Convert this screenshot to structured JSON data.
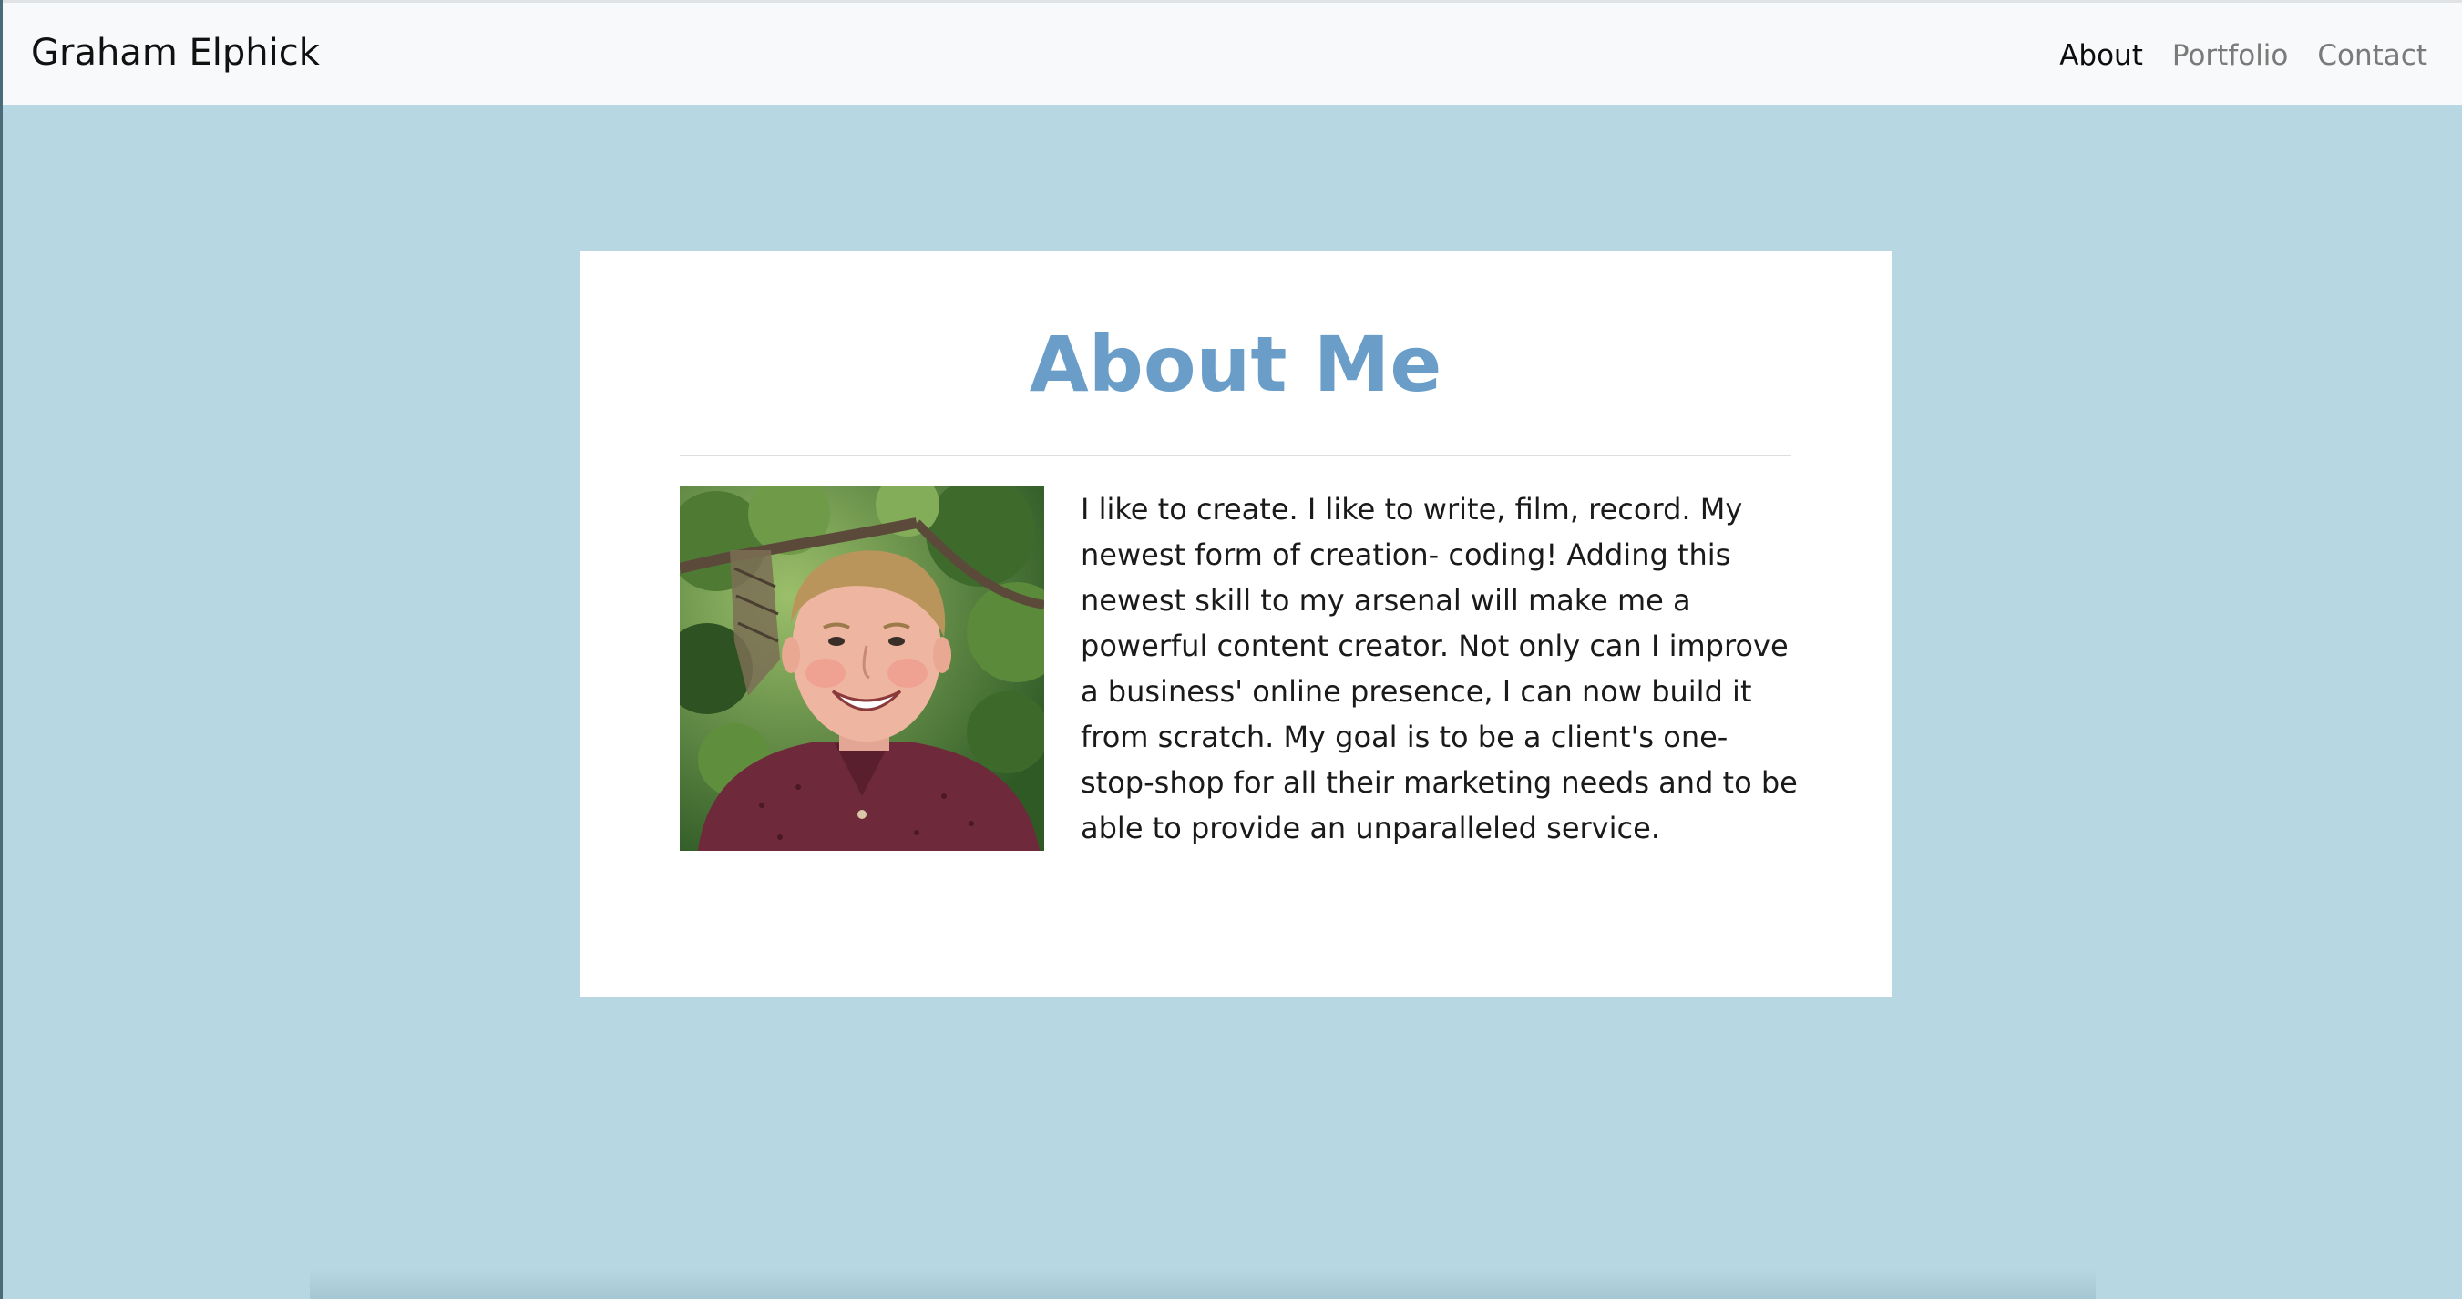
{
  "navbar": {
    "brand": "Graham Elphick",
    "links": [
      {
        "label": "About",
        "active": true
      },
      {
        "label": "Portfolio",
        "active": false
      },
      {
        "label": "Contact",
        "active": false
      }
    ]
  },
  "about": {
    "title": "About Me",
    "photo_icon": "profile-photo",
    "bio": "I like to create. I like to write, film, record. My newest form of creation- coding! Adding this newest skill to my arsenal will make me a powerful content creator. Not only can I improve a business' online presence, I can now build it from scratch. My goal is to be a client's one-stop-shop for all their marketing needs and to be able to provide an unparalleled service."
  },
  "colors": {
    "page_background": "#b7d8e3",
    "navbar_background": "#f8f9fa",
    "title_color": "#6a9ec9",
    "card_background": "#ffffff"
  }
}
